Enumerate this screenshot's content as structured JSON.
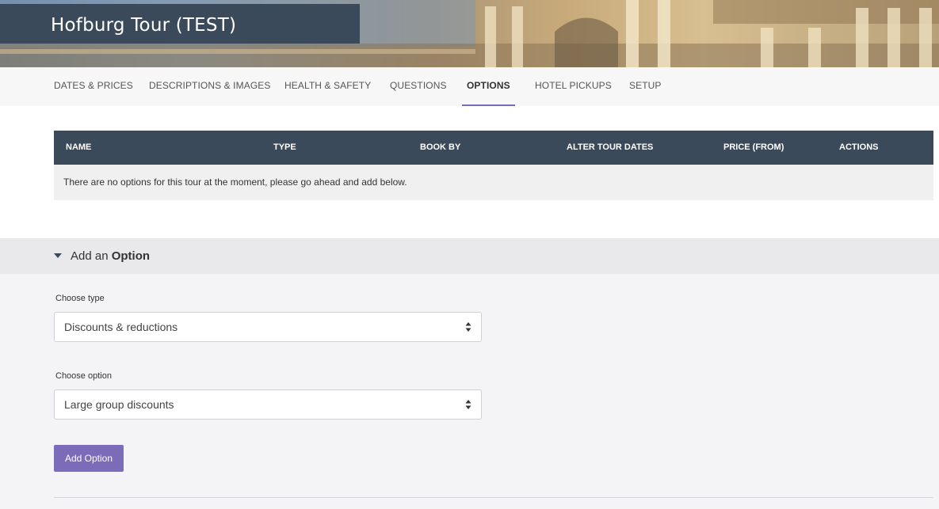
{
  "header": {
    "title": "Hofburg Tour (TEST)"
  },
  "tabs": [
    {
      "label": "DATES & PRICES",
      "active": false
    },
    {
      "label": "DESCRIPTIONS & IMAGES",
      "active": false
    },
    {
      "label": "HEALTH & SAFETY",
      "active": false
    },
    {
      "label": "QUESTIONS",
      "active": false
    },
    {
      "label": "OPTIONS",
      "active": true
    },
    {
      "label": "HOTEL PICKUPS",
      "active": false
    },
    {
      "label": "SETUP",
      "active": false
    }
  ],
  "options_table": {
    "columns": [
      "NAME",
      "TYPE",
      "BOOK BY",
      "ALTER TOUR DATES",
      "PRICE (FROM)",
      "ACTIONS"
    ],
    "empty_message": "There are no options for this tour at the moment, please go ahead and add below."
  },
  "add_option": {
    "heading_prefix": "Add an",
    "heading_bold": "Option",
    "type_label": "Choose type",
    "type_value": "Discounts & reductions",
    "option_label": "Choose option",
    "option_value": "Large group discounts",
    "button_label": "Add Option"
  },
  "colors": {
    "header_dark": "#3b4a5a",
    "accent_purple": "#7b6bb8"
  },
  "icons": {
    "section_toggle": "caret-down-icon",
    "select_arrows": "sort-arrows-icon"
  }
}
